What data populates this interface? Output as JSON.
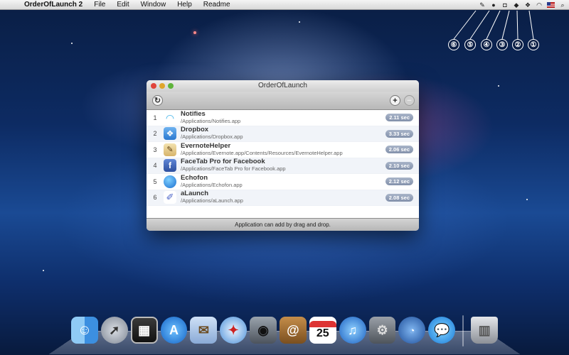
{
  "menubar": {
    "app_name": "OrderOfLaunch 2",
    "menus": [
      "File",
      "Edit",
      "Window",
      "Help",
      "Readme"
    ]
  },
  "callouts": [
    "⑥",
    "⑤",
    "④",
    "③",
    "②",
    "①"
  ],
  "window": {
    "title": "OrderOfLaunch",
    "footer_text": "Application can add by drag and drop.",
    "items": [
      {
        "index": "1",
        "name": "Notifies",
        "path": "/Applications/Notifies.app",
        "time": "2.11 sec",
        "icon": "wifi-icon"
      },
      {
        "index": "2",
        "name": "Dropbox",
        "path": "/Applications/Dropbox.app",
        "time": "3.33 sec",
        "icon": "dropbox-icon"
      },
      {
        "index": "3",
        "name": "EvernoteHelper",
        "path": "/Applications/Evernote.app/Contents/Resources/EvernoteHelper.app",
        "time": "2.06 sec",
        "icon": "evernote-icon"
      },
      {
        "index": "4",
        "name": "FaceTab Pro for Facebook",
        "path": "/Applications/FaceTab Pro for Facebook.app",
        "time": "2.10 sec",
        "icon": "facebook-icon"
      },
      {
        "index": "5",
        "name": "Echofon",
        "path": "/Applications/Echofon.app",
        "time": "2.12 sec",
        "icon": "echofon-icon"
      },
      {
        "index": "6",
        "name": "aLaunch",
        "path": "/Applications/aLaunch.app",
        "time": "2.08 sec",
        "icon": "alaunch-icon"
      }
    ]
  },
  "dock": {
    "calendar_day": "25",
    "apps": [
      "finder-icon",
      "launchpad-icon",
      "photo-booth-icon",
      "app-store-icon",
      "mail-icon",
      "safari-icon",
      "facetime-icon",
      "address-book-icon",
      "calendar-icon",
      "itunes-icon",
      "system-preferences-icon",
      "dashboard-icon",
      "messages-icon",
      "trash-icon"
    ]
  }
}
